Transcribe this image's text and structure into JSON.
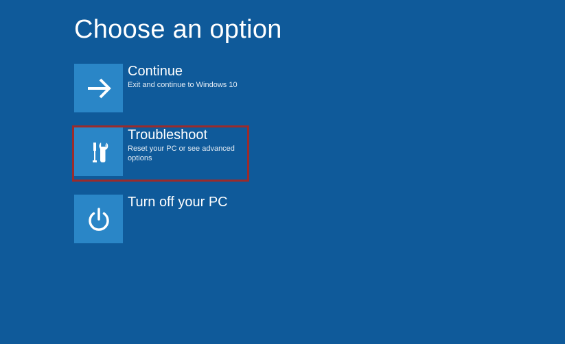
{
  "title": "Choose an option",
  "colors": {
    "background": "#0f5a9a",
    "tile": "#2a86c7",
    "highlight_border": "#9b2b2b"
  },
  "options": [
    {
      "icon": "arrow-right",
      "title": "Continue",
      "subtitle": "Exit and continue to Windows 10",
      "highlighted": false
    },
    {
      "icon": "tools",
      "title": "Troubleshoot",
      "subtitle": "Reset your PC or see advanced options",
      "highlighted": true
    },
    {
      "icon": "power",
      "title": "Turn off your PC",
      "subtitle": "",
      "highlighted": false
    }
  ]
}
